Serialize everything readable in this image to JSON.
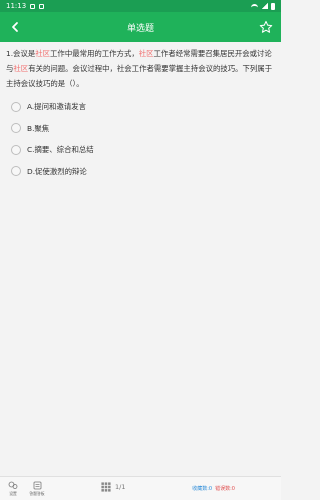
{
  "status_bar": {
    "time": "11:13"
  },
  "header": {
    "title": "单选题"
  },
  "question": {
    "parts": [
      {
        "text": "1.会议是",
        "hl": false
      },
      {
        "text": "社区",
        "hl": true
      },
      {
        "text": "工作中最常用的工作方式，",
        "hl": false
      },
      {
        "text": "社区",
        "hl": true
      },
      {
        "text": "工作者经常需要召集居民开会或讨论与",
        "hl": false
      },
      {
        "text": "社区",
        "hl": true
      },
      {
        "text": "有关的问题。会议过程中，社会工作者需要掌握主持会议的技巧。下列属于主持会议技巧的是（）。",
        "hl": false
      }
    ],
    "highlight_color": "#f26d6d"
  },
  "options": [
    {
      "label": "A.提问和邀请发言"
    },
    {
      "label": "B.聚焦"
    },
    {
      "label": "C.摘要、综合和总结"
    },
    {
      "label": "D.促使激烈的辩论"
    }
  ],
  "bottom": {
    "tool1_label": "设置",
    "tool2_label": "答题答板",
    "pager": "1/1",
    "fav_label": "收藏数:0",
    "wrong_label": "错误数:0"
  },
  "colors": {
    "status_bar": "#1b9e53",
    "app_bar": "#1fb25a",
    "fav": "#2b8bd8",
    "wrong": "#e05050"
  },
  "icons": {
    "back": "chevron-left-icon",
    "favorite": "star-outline-icon",
    "tool1": "gear-icon",
    "tool2": "answer-sheet-icon",
    "pager": "grid-icon"
  }
}
